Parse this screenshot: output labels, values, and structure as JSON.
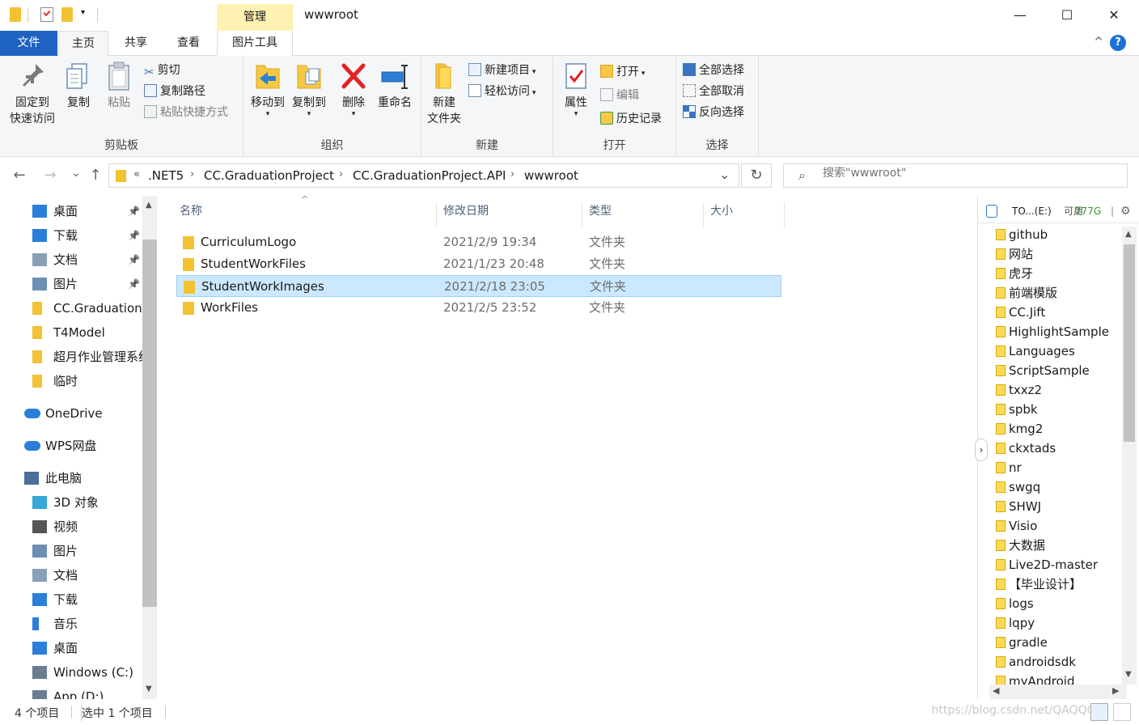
{
  "window": {
    "title": "wwwroot",
    "manage_label": "管理",
    "minimize": "—",
    "maximize": "☐",
    "close": "✕"
  },
  "tabs": {
    "file": "文件",
    "home": "主页",
    "share": "共享",
    "view": "查看",
    "picture_tools": "图片工具"
  },
  "help_label": "?",
  "collapse_label": "^",
  "ribbon": {
    "clipboard": {
      "label": "剪贴板",
      "pin": "固定到快速访问",
      "pin_line1": "固定到",
      "pin_line2": "快速访问",
      "copy": "复制",
      "paste": "粘贴",
      "cut": "剪切",
      "copy_path": "复制路径",
      "paste_shortcut": "粘贴快捷方式"
    },
    "organize": {
      "label": "组织",
      "move_to": "移动到",
      "copy_to": "复制到",
      "delete": "删除",
      "rename": "重命名"
    },
    "new": {
      "label": "新建",
      "new_folder_line1": "新建",
      "new_folder_line2": "文件夹",
      "new_item": "新建项目",
      "easy_access": "轻松访问"
    },
    "open": {
      "label": "打开",
      "properties": "属性",
      "open": "打开",
      "edit": "编辑",
      "history": "历史记录"
    },
    "select": {
      "label": "选择",
      "select_all": "全部选择",
      "select_none": "全部取消",
      "invert": "反向选择"
    }
  },
  "address": {
    "back": "←",
    "forward": "→",
    "recent": "⌄",
    "up": "↑",
    "overflow": "«",
    "crumbs": [
      ".NET5",
      "CC.GraduationProject",
      "CC.GraduationProject.API",
      "wwwroot"
    ],
    "separator": "›",
    "dropdown": "⌄",
    "refresh": "↻",
    "search_placeholder": "搜索\"wwwroot\""
  },
  "nav": {
    "items": [
      {
        "label": "桌面",
        "icon": "desktop-icon",
        "pinned": true
      },
      {
        "label": "下载",
        "icon": "download-icon",
        "pinned": true
      },
      {
        "label": "文档",
        "icon": "document-icon",
        "pinned": true
      },
      {
        "label": "图片",
        "icon": "pictures-icon",
        "pinned": true
      },
      {
        "label": "CC.GraduationP",
        "icon": "folder-icon",
        "pinned": false
      },
      {
        "label": "T4Model",
        "icon": "folder-icon",
        "pinned": false
      },
      {
        "label": "超月作业管理系统",
        "icon": "folder-icon",
        "pinned": false
      },
      {
        "label": "临时",
        "icon": "folder-icon",
        "pinned": false
      },
      {
        "label": "OneDrive",
        "icon": "cloud-icon",
        "pinned": false
      },
      {
        "label": "WPS网盘",
        "icon": "cloud-icon",
        "pinned": false
      },
      {
        "label": "此电脑",
        "icon": "computer-icon",
        "pinned": false
      },
      {
        "label": "3D 对象",
        "icon": "cube-icon",
        "pinned": false
      },
      {
        "label": "视频",
        "icon": "video-icon",
        "pinned": false
      },
      {
        "label": "图片",
        "icon": "pictures-icon",
        "pinned": false
      },
      {
        "label": "文档",
        "icon": "document-icon",
        "pinned": false
      },
      {
        "label": "下载",
        "icon": "download-icon",
        "pinned": false
      },
      {
        "label": "音乐",
        "icon": "music-icon",
        "pinned": false
      },
      {
        "label": "桌面",
        "icon": "desktop-icon",
        "pinned": false
      },
      {
        "label": "Windows (C:)",
        "icon": "drive-icon",
        "pinned": false
      },
      {
        "label": "App (D:)",
        "icon": "drive-icon",
        "pinned": false
      }
    ],
    "pin_glyph": "📌"
  },
  "columns": {
    "name": "名称",
    "date": "修改日期",
    "type": "类型",
    "size": "大小"
  },
  "files": [
    {
      "name": "CurriculumLogo",
      "date": "2021/2/9 19:34",
      "type": "文件夹",
      "selected": false
    },
    {
      "name": "StudentWorkFiles",
      "date": "2021/1/23 20:48",
      "type": "文件夹",
      "selected": false
    },
    {
      "name": "StudentWorkImages",
      "date": "2021/2/18 23:05",
      "type": "文件夹",
      "selected": true
    },
    {
      "name": "WorkFiles",
      "date": "2021/2/5 23:52",
      "type": "文件夹",
      "selected": false
    }
  ],
  "side_panel": {
    "drive_label": "TO...(E:)",
    "free_label": "可用",
    "free_value": "277G",
    "items": [
      "github",
      "网站",
      "虎牙",
      "前端模版",
      "CC.Jift",
      "HighlightSample",
      "Languages",
      "ScriptSample",
      "txxz2",
      "spbk",
      "kmg2",
      "ckxtads",
      "nr",
      "swgq",
      "SHWJ",
      "Visio",
      "大数据",
      "Live2D-master",
      "【毕业设计】",
      "logs",
      "lqpy",
      "gradle",
      "androidsdk",
      "myAndroid"
    ]
  },
  "status": {
    "count": "4 个项目",
    "selected": "选中 1 个项目",
    "watermark": "https://blog.csdn.net/QAQQQ..."
  },
  "colors": {
    "accent": "#1e63c2",
    "selection_bg": "#cce8ff",
    "selection_border": "#99d1ff",
    "manage_bg": "#fdf2b1",
    "folder": "#f1c232",
    "free_space": "#2c9a2c"
  }
}
